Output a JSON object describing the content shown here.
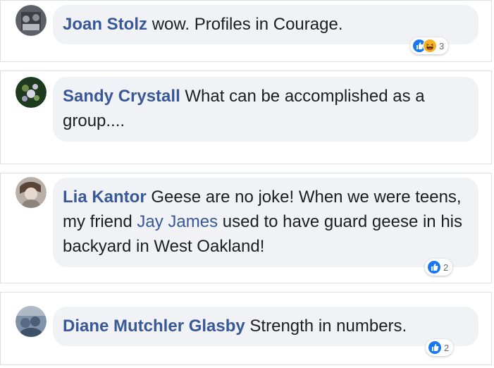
{
  "comments": [
    {
      "author": "Joan Stolz",
      "text": "wow. Profiles in Courage.",
      "reaction_count": "3",
      "reactions": [
        "like-icon",
        "haha-icon"
      ]
    },
    {
      "author": "Sandy Crystall",
      "text": "What can be accomplished as a group...."
    },
    {
      "author": "Lia Kantor",
      "text_before": "Geese are no joke! When we were teens, my friend",
      "mention": "Jay James",
      "text_after": "used to have guard geese in his backyard in West Oakland!",
      "reaction_count": "2",
      "reactions": [
        "like-icon"
      ]
    },
    {
      "author": "Diane Mutchler Glasby",
      "text": "Strength in numbers.",
      "reaction_count": "2",
      "reactions": [
        "like-icon"
      ]
    }
  ],
  "colors": {
    "author_link": "#385898",
    "bubble": "#f0f2f5",
    "like_blue": "#1877f2",
    "haha_yellow": "#f7b125"
  }
}
